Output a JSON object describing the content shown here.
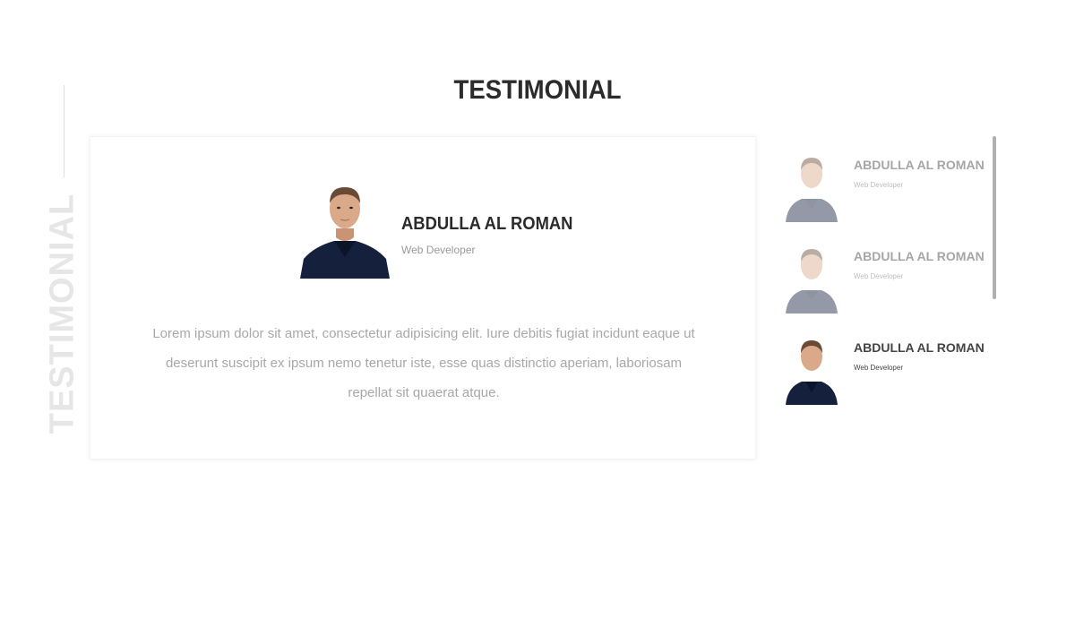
{
  "section": {
    "title": "TESTIMONIAL",
    "side_title": "TESTIMONIAL"
  },
  "featured": {
    "name": "ABDULLA AL ROMAN",
    "role": "Web Developer",
    "quote": "Lorem ipsum dolor sit amet, consectetur adipisicing elit. Iure debitis fugiat incidunt eaque ut deserunt suscipit ex ipsum nemo tenetur iste, esse quas distinctio aperiam, laboriosam repellat sit quaerat atque."
  },
  "thumbs": [
    {
      "name": "ABDULLA AL ROMAN",
      "role": "Web Developer",
      "state": "faded"
    },
    {
      "name": "ABDULLA AL ROMAN",
      "role": "Web Developer",
      "state": "faded"
    },
    {
      "name": "ABDULLA AL ROMAN",
      "role": "Web Developer",
      "state": "active"
    }
  ],
  "colors": {
    "title": "#2b2b2b",
    "side_title": "#e6e6e6",
    "body_text": "#a8a8a8",
    "shirt": "#15203d",
    "skin": "#d9a98a",
    "hair": "#6b4a35",
    "scrollbar": "#b0b0b0"
  }
}
